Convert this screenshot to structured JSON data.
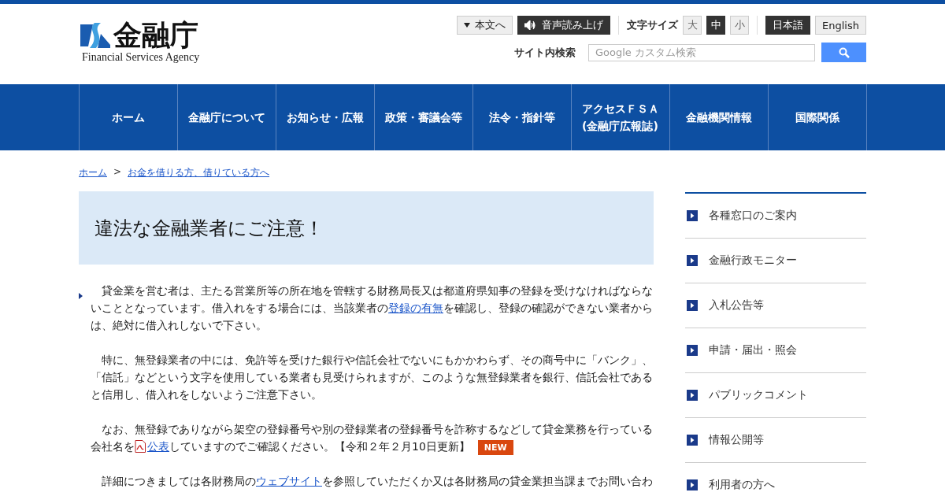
{
  "logo": {
    "name": "金融庁",
    "subtitle": "Financial Services Agency"
  },
  "utility": {
    "skip_link": "本文へ",
    "read_aloud": "音声読み上げ",
    "font_size_label": "文字サイズ",
    "font_sizes": [
      {
        "label": "大",
        "selected": false
      },
      {
        "label": "中",
        "selected": true
      },
      {
        "label": "小",
        "selected": false
      }
    ],
    "languages": [
      {
        "label": "日本語",
        "selected": true
      },
      {
        "label": "English",
        "selected": false
      }
    ]
  },
  "search": {
    "label": "サイト内検索",
    "placeholder": "Google カスタム検索"
  },
  "nav": [
    {
      "label": "ホーム"
    },
    {
      "label": "金融庁について"
    },
    {
      "label": "お知らせ・広報"
    },
    {
      "label": "政策・審議会等"
    },
    {
      "label": "法令・指針等"
    },
    {
      "label": "アクセスＦＳＡ\n(金融庁広報誌)"
    },
    {
      "label": "金融機関情報"
    },
    {
      "label": "国際関係"
    }
  ],
  "breadcrumb": {
    "separator": ">",
    "items": [
      "ホーム",
      "お金を借りる方、借りている方へ"
    ]
  },
  "page_title": "違法な金融業者にご注意！",
  "paragraphs": [
    {
      "segments": [
        {
          "kind": "text",
          "text": "貸金業を営む者は、主たる営業所等の所在地を管轄する財務局長又は都道府県知事の登録を受けなければならないこととなっています。借入れをする場合には、当該業者の"
        },
        {
          "kind": "link",
          "text": "登録の有無"
        },
        {
          "kind": "text",
          "text": "を確認し、登録の確認ができない業者からは、絶対に借入れしないで下さい。"
        }
      ]
    },
    {
      "segments": [
        {
          "kind": "text",
          "text": "特に、無登録業者の中には、免許等を受けた銀行や信託会社でないにもかかわらず、その商号中に「バンク」、「信託」などという文字を使用している業者も見受けられますが、このような無登録業者を銀行、信託会社であると信用し、借入れをしないようご注意下さい。"
        }
      ]
    },
    {
      "segments": [
        {
          "kind": "text",
          "text": "なお、無登録でありながら架空の登録番号や別の登録業者の登録番号を詐称するなどして貸金業務を行っている会社名を"
        },
        {
          "kind": "pdf",
          "text": "公表"
        },
        {
          "kind": "text",
          "text": "していますのでご確認ください。【令和２年２月10日更新】"
        }
      ],
      "badge": "NEW"
    },
    {
      "segments": [
        {
          "kind": "text",
          "text": "詳細につきましては各財務局の"
        },
        {
          "kind": "link",
          "text": "ウェブサイト"
        },
        {
          "kind": "text",
          "text": "を参照していただくか又は各財務局の貸金業担当課までお問い合わ"
        }
      ]
    }
  ],
  "sidebar": [
    "各種窓口のご案内",
    "金融行政モニター",
    "入札公告等",
    "申請・届出・照会",
    "パブリックコメント",
    "情報公開等",
    "利用者の方へ"
  ]
}
